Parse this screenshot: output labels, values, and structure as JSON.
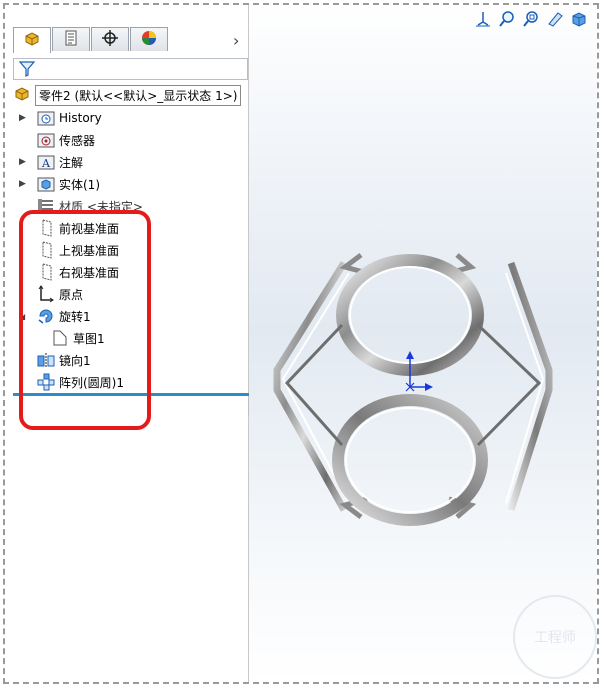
{
  "tabs": [
    {
      "name": "feature-manager-tab",
      "icon": "part-icon"
    },
    {
      "name": "property-manager-tab",
      "icon": "property-manager-icon"
    },
    {
      "name": "configuration-manager-tab",
      "icon": "crosshair-icon"
    },
    {
      "name": "display-manager-tab",
      "icon": "appearance-ball-icon"
    }
  ],
  "tabs_more": "›",
  "tree": {
    "root_label": "零件2  (默认<<默认>_显示状态 1>)",
    "items": [
      {
        "label": "History",
        "icon": "history-folder-icon",
        "expandable": true
      },
      {
        "label": "传感器",
        "icon": "sensor-folder-icon",
        "expandable": false
      },
      {
        "label": "注解",
        "icon": "annotation-folder-icon",
        "expandable": true
      },
      {
        "label": "实体(1)",
        "icon": "solid-bodies-folder-icon",
        "expandable": true
      },
      {
        "label": "材质 <未指定>",
        "icon": "material-icon",
        "expandable": false
      },
      {
        "label": "前视基准面",
        "icon": "plane-icon",
        "expandable": false
      },
      {
        "label": "上视基准面",
        "icon": "plane-icon",
        "expandable": false
      },
      {
        "label": "右视基准面",
        "icon": "plane-icon",
        "expandable": false
      },
      {
        "label": "原点",
        "icon": "origin-icon",
        "expandable": false
      },
      {
        "label": "旋转1",
        "icon": "revolve-icon",
        "expandable": true
      },
      {
        "label": "草图1",
        "icon": "sketch-icon",
        "expandable": false
      },
      {
        "label": "镜向1",
        "icon": "mirror-icon",
        "expandable": false
      },
      {
        "label": "阵列(圆周)1",
        "icon": "circular-pattern-icon",
        "expandable": false
      }
    ]
  },
  "viewport_tools": [
    "view-orientation-icon",
    "zoom-fit-icon",
    "zoom-area-icon",
    "section-view-icon",
    "display-style-icon"
  ],
  "colors": {
    "highlight": "#e31b1b",
    "rollback_bar": "#2c8ec9",
    "part_icon": "#f0b42a"
  },
  "watermark": "工程师"
}
